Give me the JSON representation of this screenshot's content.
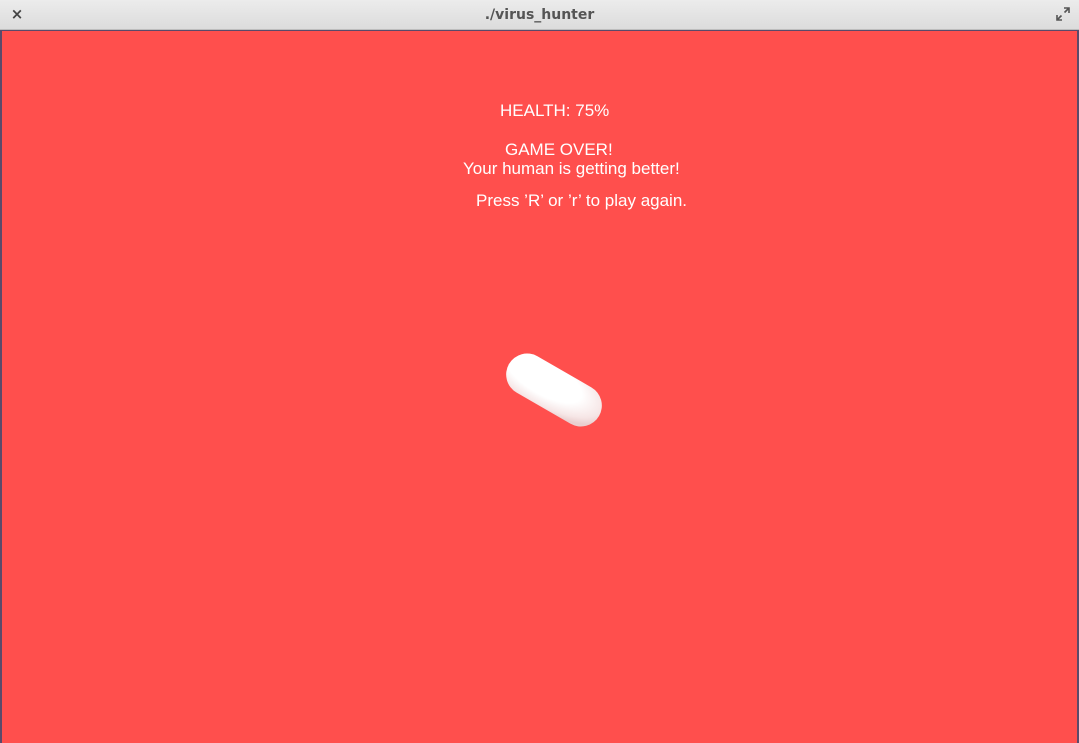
{
  "window": {
    "title": "./virus_hunter",
    "close_icon": "close-icon",
    "maximize_icon": "maximize-icon"
  },
  "game": {
    "background_color": "#ff4f4d",
    "health_text": "HEALTH: 75%",
    "health_percent": 75,
    "game_over_text": "GAME OVER!",
    "result_text": "Your human is getting better!",
    "restart_text": "Press ’R’ or ’r’ to play again.",
    "player_object": "white-pill"
  }
}
